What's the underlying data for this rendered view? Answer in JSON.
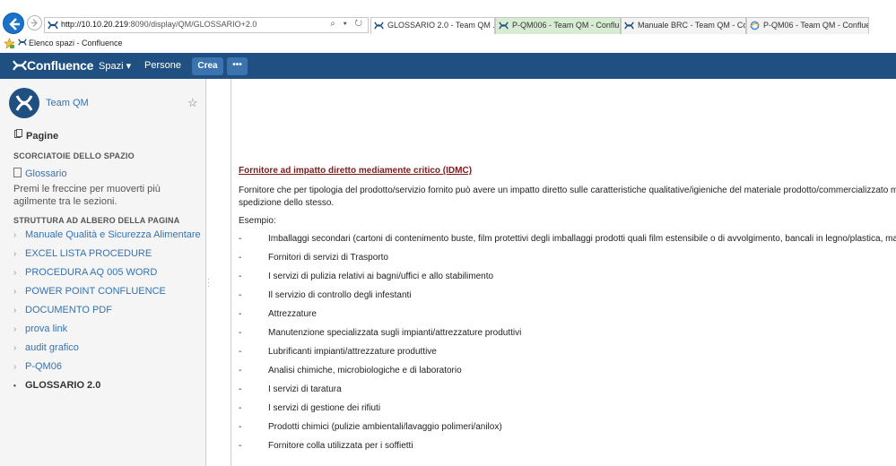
{
  "browser": {
    "address": {
      "host": "http://10.10.20.219",
      "path": ":8090/display/QM/GLOSSARIO+2.0",
      "tools": "⌕ ▾ ↻"
    },
    "tabs": [
      {
        "label": "GLOSSARIO 2.0 - Team QM ...",
        "close": "✕",
        "state": "active"
      },
      {
        "label": "P-QM006 - Team QM - Conflu...",
        "state": "green"
      },
      {
        "label": "Manuale BRC - Team QM - Co...",
        "state": "normal"
      },
      {
        "label": "P-QM06 - Team QM - Conflue...",
        "state": "normal"
      }
    ],
    "favorites_item": "Elenco spazi - Confluence"
  },
  "header": {
    "logo": "Confluence",
    "spaces": "Spazi ▾",
    "people": "Persone",
    "create": "Crea",
    "more": "•••",
    "color": "#205081"
  },
  "sidebar": {
    "space_name": "Team QM",
    "star": "☆",
    "pages_label": "Pagine",
    "shortcuts_heading": "SCORCIATOIE DELLO SPAZIO",
    "shortcut": "Glossario",
    "hint": "Premi le freccine per muoverti più agilmente tra le sezioni.",
    "tree_heading": "STRUTTURA AD ALBERO DELLA PAGINA",
    "tree": [
      {
        "label": "Manuale Qualità e Sicurezza Alimentare",
        "caret": "›"
      },
      {
        "label": "EXCEL LISTA PROCEDURE",
        "caret": "›"
      },
      {
        "label": "PROCEDURA AQ 005 WORD",
        "caret": "›"
      },
      {
        "label": "POWER POINT CONFLUENCE",
        "caret": "›"
      },
      {
        "label": "DOCUMENTO PDF",
        "caret": "›"
      },
      {
        "label": "prova link",
        "caret": "›"
      },
      {
        "label": "audit grafico",
        "caret": "›"
      },
      {
        "label": "P-QM06",
        "caret": "›"
      },
      {
        "label": "GLOSSARIO 2.0",
        "caret": "•"
      }
    ]
  },
  "content": {
    "term": "Fornitore ad impatto diretto mediamente critico (IDMC)",
    "definition_line1": "Fornitore che per tipologia del prodotto/servizio fornito può avere un impatto diretto sulle caratteristiche qualitative/igieniche del materiale prodotto/commercializzato ma in",
    "definition_line2": "spedizione dello stesso.",
    "example_label": "Esempio:",
    "bullet_marker": "-",
    "bullets": [
      "Imballaggi secondari (cartoni di contenimento buste, film protettivi degli imballaggi prodotti quali film estensibile o di avvolgimento, bancali in legno/plastica, mandr",
      "Fornitori di servizi di Trasporto",
      "I servizi di pulizia relativi ai bagni/uffici e allo stabilimento",
      "Il servizio di controllo degli infestanti",
      "Attrezzature",
      "Manutenzione specializzata sugli impianti/attrezzature produttivi",
      "Lubrificanti impianti/attrezzature produttive",
      "Analisi chimiche, microbiologiche e di laboratorio",
      "I servizi di taratura",
      "I servizi di gestione dei rifiuti",
      "Prodotti chimici (pulizie ambientali/lavaggio polimeri/anilox)",
      "Fornitore colla utilizzata per i soffietti"
    ]
  }
}
